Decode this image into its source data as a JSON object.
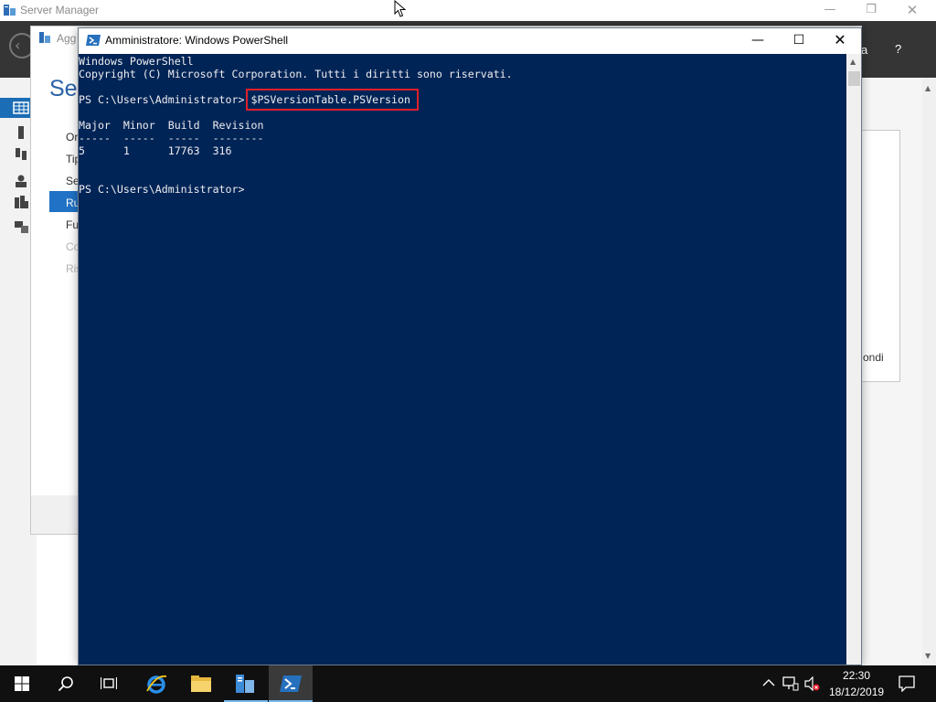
{
  "server_manager": {
    "title": "Server Manager",
    "header_text": "a",
    "help_label": "?",
    "window_controls": {
      "minimize": "—",
      "maximize": "❐",
      "close": "✕"
    }
  },
  "wizard": {
    "title": "Agg",
    "heading": "Sel",
    "steps": [
      {
        "label": "Or",
        "state": "normal"
      },
      {
        "label": "Tip",
        "state": "normal"
      },
      {
        "label": "Se",
        "state": "normal"
      },
      {
        "label": "Ru",
        "state": "active"
      },
      {
        "label": "Fu",
        "state": "normal"
      },
      {
        "label": "Co",
        "state": "disabled"
      },
      {
        "label": "Ris",
        "state": "disabled"
      }
    ],
    "right_panel_text": "ondi"
  },
  "powershell": {
    "title": "Amministratore: Windows PowerShell",
    "window_controls": {
      "minimize": "—",
      "maximize": "☐",
      "close": "✕"
    },
    "console": {
      "banner_line1": "Windows PowerShell",
      "banner_line2": "Copyright (C) Microsoft Corporation. Tutti i diritti sono riservati.",
      "prompt1": "PS C:\\Users\\Administrator> ",
      "command": "$PSVersionTable.PSVersion",
      "table_header": "Major  Minor  Build  Revision",
      "table_separator": "-----  -----  -----  --------",
      "table_row": "5      1      17763  316",
      "prompt2": "PS C:\\Users\\Administrator>"
    },
    "colors": {
      "console_background": "#012456",
      "console_text": "#eeedf0",
      "highlight": "#e0202b"
    }
  },
  "taskbar": {
    "items": [
      "start-button",
      "search-button",
      "task-view-button",
      "internet-explorer",
      "file-explorer",
      "server-manager",
      "powershell"
    ],
    "active_item": "powershell",
    "clock": {
      "time": "22:30",
      "date": "18/12/2019"
    }
  }
}
